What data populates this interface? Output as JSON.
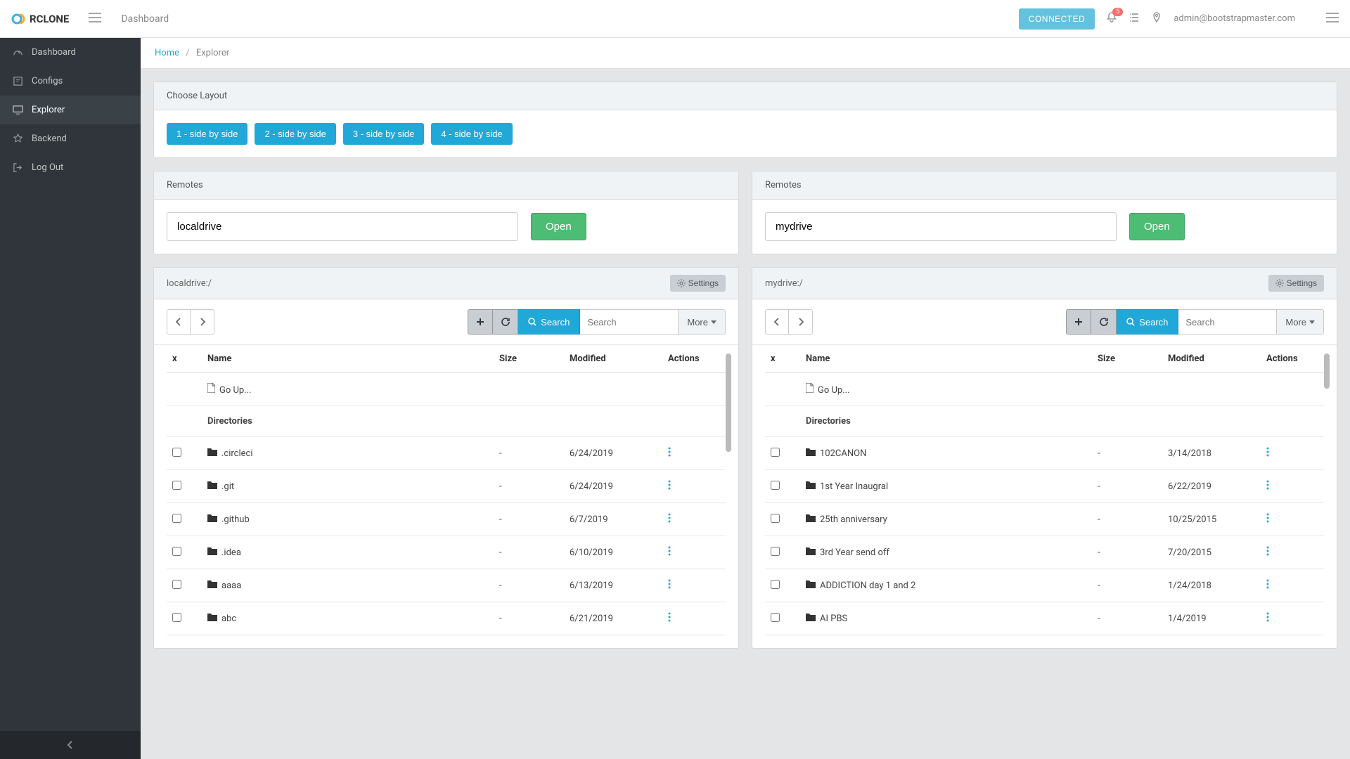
{
  "brand": "RCLONE",
  "header": {
    "title": "Dashboard",
    "connected": "CONNECTED",
    "notif_count": "5",
    "user_email": "admin@bootstrapmaster.com"
  },
  "sidebar": {
    "items": [
      {
        "label": "Dashboard"
      },
      {
        "label": "Configs"
      },
      {
        "label": "Explorer"
      },
      {
        "label": "Backend"
      },
      {
        "label": "Log Out"
      }
    ]
  },
  "breadcrumb": {
    "home": "Home",
    "current": "Explorer"
  },
  "layout_card": {
    "title": "Choose Layout",
    "buttons": [
      "1 - side by side",
      "2 - side by side",
      "3 - side by side",
      "4 - side by side"
    ]
  },
  "labels": {
    "remotes": "Remotes",
    "open": "Open",
    "settings": "Settings",
    "search": "Search",
    "search_ph": "Search",
    "more": "More",
    "go_up": "Go Up...",
    "directories": "Directories",
    "cols": {
      "x": "x",
      "name": "Name",
      "size": "Size",
      "modified": "Modified",
      "actions": "Actions"
    }
  },
  "left": {
    "remote_value": "localdrive",
    "path": "localdrive:/",
    "rows": [
      {
        "name": ".circleci",
        "size": "-",
        "modified": "6/24/2019"
      },
      {
        "name": ".git",
        "size": "-",
        "modified": "6/24/2019"
      },
      {
        "name": ".github",
        "size": "-",
        "modified": "6/7/2019"
      },
      {
        "name": ".idea",
        "size": "-",
        "modified": "6/10/2019"
      },
      {
        "name": "aaaa",
        "size": "-",
        "modified": "6/13/2019"
      },
      {
        "name": "abc",
        "size": "-",
        "modified": "6/21/2019"
      }
    ]
  },
  "right": {
    "remote_value": "mydrive",
    "path": "mydrive:/",
    "rows": [
      {
        "name": "102CANON",
        "size": "-",
        "modified": "3/14/2018"
      },
      {
        "name": "1st Year Inaugral",
        "size": "-",
        "modified": "6/22/2019"
      },
      {
        "name": "25th anniversary",
        "size": "-",
        "modified": "10/25/2015"
      },
      {
        "name": "3rd Year send off",
        "size": "-",
        "modified": "7/20/2015"
      },
      {
        "name": "ADDICTION day 1 and 2",
        "size": "-",
        "modified": "1/24/2018"
      },
      {
        "name": "AI PBS",
        "size": "-",
        "modified": "1/4/2019"
      }
    ]
  }
}
